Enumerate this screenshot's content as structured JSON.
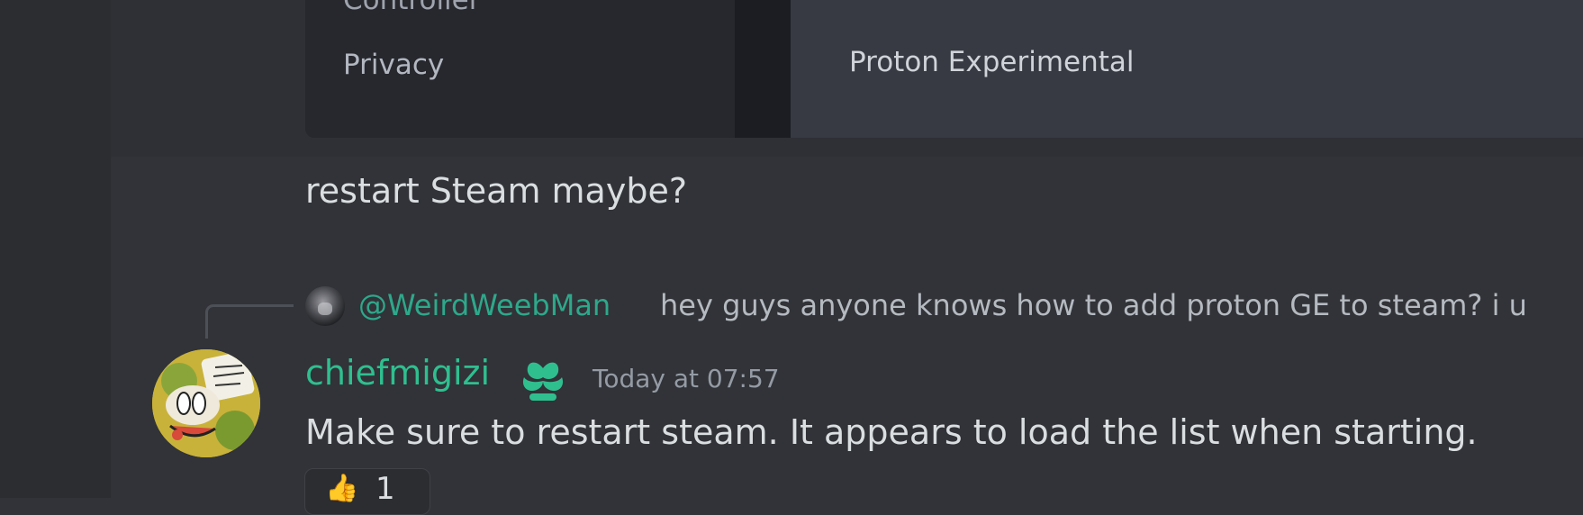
{
  "attachment": {
    "left_panel": {
      "partial_item": "Controller",
      "item": "Privacy"
    },
    "right_panel": {
      "partial_item": "",
      "item": "Proton Experimental"
    }
  },
  "messages": [
    {
      "text": "restart Steam maybe?"
    },
    {
      "reply": {
        "mention": "@WeirdWeebMan",
        "preview": "hey guys anyone knows how to add proton GE to steam? i u"
      },
      "author": "chiefmigizi",
      "role_icon": "leaf-badge-icon",
      "timestamp": "Today at 07:57",
      "text": "Make sure to restart steam. It appears to load the list when starting.",
      "reaction": {
        "emoji": "👍",
        "count": "1"
      }
    }
  ],
  "colors": {
    "author": "#2fbf8f",
    "mention": "#2ea88a",
    "background": "#313338"
  }
}
